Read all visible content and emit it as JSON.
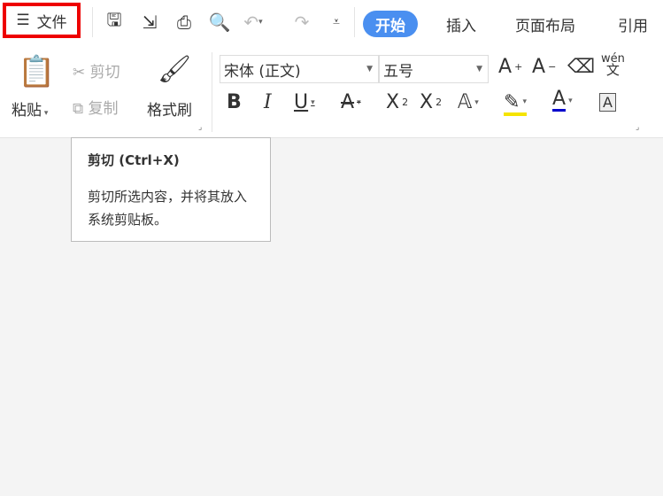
{
  "file_menu": {
    "label": "文件",
    "icon": "hamburger-icon"
  },
  "quick_access": [
    "save-icon",
    "export-icon",
    "print-icon",
    "print-preview-icon",
    "undo-icon",
    "redo-icon",
    "customize-icon"
  ],
  "tabs": [
    {
      "label": "开始",
      "active": true
    },
    {
      "label": "插入"
    },
    {
      "label": "页面布局"
    },
    {
      "label": "引用"
    }
  ],
  "clipboard": {
    "paste": "粘贴",
    "cut": "剪切",
    "copy": "复制",
    "format_painter": "格式刷"
  },
  "font": {
    "name": "宋体 (正文)",
    "size": "五号",
    "pinyin": "wén"
  },
  "tooltip": {
    "title": "剪切 (Ctrl+X)",
    "description": "剪切所选内容，并将其放入系统剪贴板。"
  },
  "colors": {
    "accent": "#4a8ff0",
    "highlight": "#f5e400",
    "font_color": "#0000cc",
    "frame": "#e00000"
  }
}
